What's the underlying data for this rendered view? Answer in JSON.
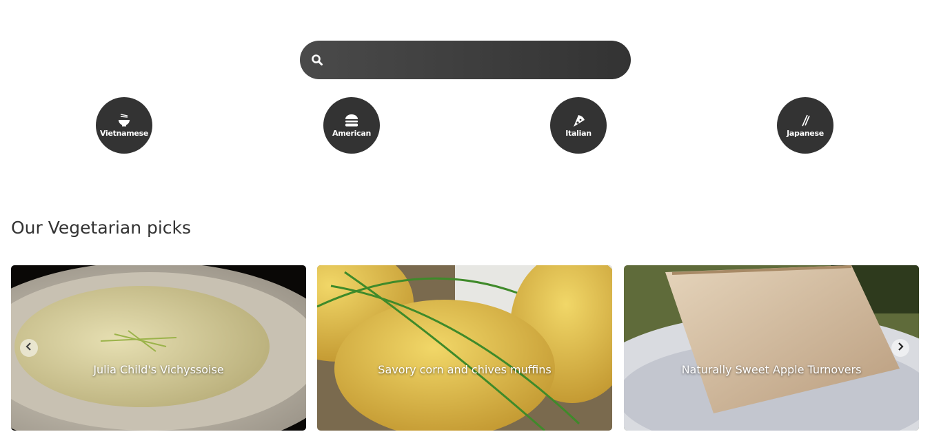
{
  "search": {
    "placeholder": "",
    "value": "",
    "icon": "search-icon"
  },
  "cuisines": [
    {
      "label": "Vietnamese",
      "icon": "noodle-bowl-icon"
    },
    {
      "label": "American",
      "icon": "burger-icon"
    },
    {
      "label": "Italian",
      "icon": "pizza-icon"
    },
    {
      "label": "Japanese",
      "icon": "chopsticks-icon"
    }
  ],
  "section": {
    "title": "Our Vegetarian picks"
  },
  "recipes": [
    {
      "title": "Julia Child's Vichyssoise"
    },
    {
      "title": "Savory corn and chives muffins"
    },
    {
      "title": "Naturally Sweet Apple Turnovers"
    }
  ],
  "carousel": {
    "prev_icon": "chevron-left-icon",
    "next_icon": "chevron-right-icon"
  },
  "colors": {
    "dark": "#333333",
    "text": "#333333",
    "background": "#ffffff"
  }
}
